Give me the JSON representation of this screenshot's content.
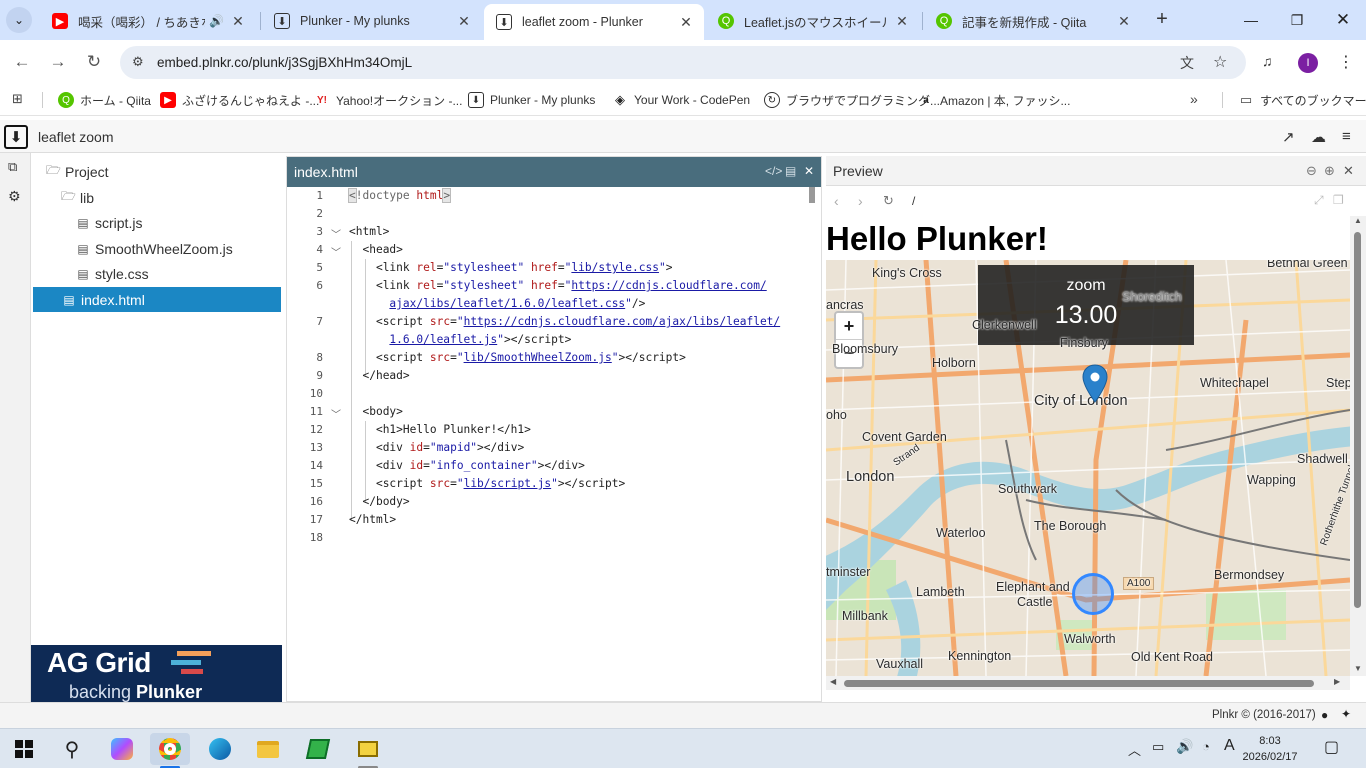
{
  "browser": {
    "tabs": [
      {
        "title": "喝采（喝彩） / ちあきなお",
        "icon": "youtube-icon",
        "audio": true
      },
      {
        "title": "Plunker - My plunks",
        "icon": "plunker-icon"
      },
      {
        "title": "leaflet zoom - Plunker",
        "icon": "plunker-icon",
        "active": true
      },
      {
        "title": "Leaflet.jsのマウスホイールZoom",
        "icon": "qiita-icon"
      },
      {
        "title": "記事を新規作成 - Qiita",
        "icon": "qiita-icon"
      }
    ],
    "url": "embed.plnkr.co/plunk/j3SgjBXhHm34OmjL",
    "profile_initial": "I",
    "bookmarks": [
      {
        "label": "ホーム - Qiita",
        "icon": "qiita-icon"
      },
      {
        "label": "ふざけるんじゃねえよ -...",
        "icon": "youtube-icon"
      },
      {
        "label": "Yahoo!オークション -...",
        "icon": "yahoo-icon"
      },
      {
        "label": "Plunker - My plunks",
        "icon": "plunker-icon"
      },
      {
        "label": "Your Work - CodePen",
        "icon": "codepen-icon"
      },
      {
        "label": "ブラウザでプログラミング...",
        "icon": "paiza-icon"
      },
      {
        "label": "Amazon | 本, ファッシ...",
        "icon": "amazon-icon"
      }
    ],
    "all_bookmarks": "すべてのブックマーク"
  },
  "app": {
    "title": "leaflet zoom",
    "tree": [
      {
        "label": "Project",
        "kind": "folder"
      },
      {
        "label": "lib",
        "kind": "folder"
      },
      {
        "label": "script.js",
        "kind": "file"
      },
      {
        "label": "SmoothWheelZoom.js",
        "kind": "file"
      },
      {
        "label": "style.css",
        "kind": "file"
      },
      {
        "label": "index.html",
        "kind": "file",
        "active": true
      }
    ],
    "ad": {
      "line1": "AG Grid",
      "line2a": "backing ",
      "line2b": "Plunker"
    },
    "editor_tab": "index.html",
    "line_numbers": [
      "1",
      "2",
      "3",
      "4",
      "5",
      "6",
      "",
      "7",
      "",
      "8",
      "9",
      "10",
      "11",
      "12",
      "13",
      "14",
      "15",
      "16",
      "17",
      "18"
    ],
    "preview_title": "Preview",
    "preview_path": "/",
    "preview_h1": "Hello Plunker!",
    "zoom_label": "zoom",
    "zoom_value": "13.00",
    "zoom_in": "+",
    "zoom_out": "−",
    "map_labels": [
      "King's Cross",
      "Bethnal Green",
      "Shoreditch",
      "ancras",
      "Clerkenwell",
      "Bloomsbury",
      "Finsbury",
      "Holborn",
      "Whitechapel",
      "Step",
      "City of London",
      "oho",
      "Covent Garden",
      "Strand",
      "Shadwell",
      "London",
      "Wapping",
      "Southwark",
      "Rotherhithe Tunnel",
      "The Borough",
      "Waterloo",
      "tminster",
      "Elephant and",
      "Castle",
      "A100",
      "Bermondsey",
      "Lambeth",
      "Millbank",
      "Walworth",
      "Old Kent Road",
      "Kennington",
      "Vauxhall"
    ],
    "footer": "Plnkr © (2016-2017)"
  },
  "taskbar": {
    "time": "8:03",
    "date": "2026/02/17"
  }
}
